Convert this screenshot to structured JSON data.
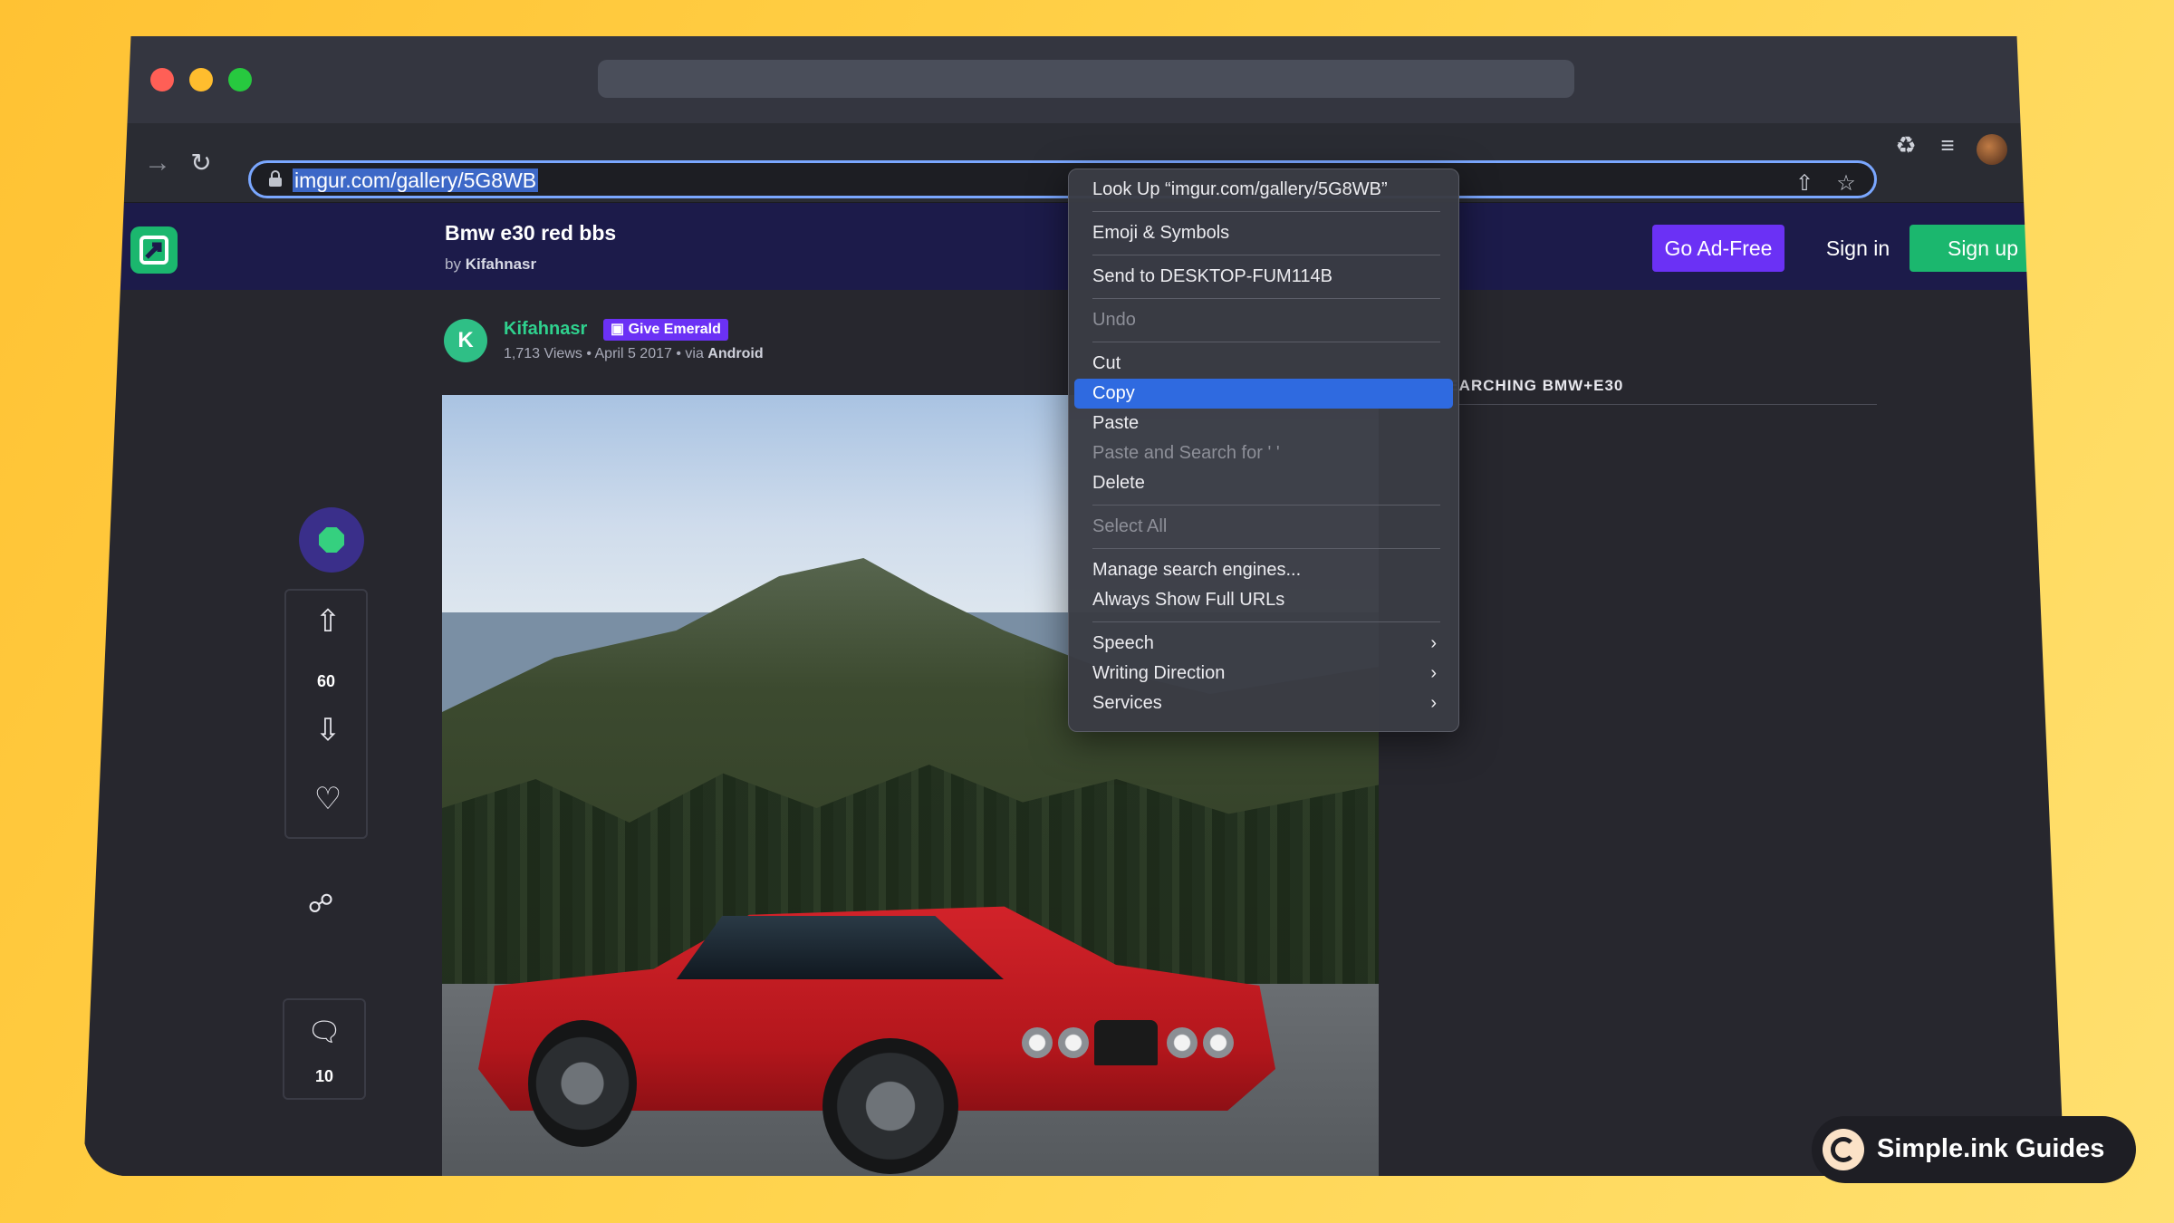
{
  "browser": {
    "url": "imgur.com/gallery/5G8WB"
  },
  "header": {
    "title": "Bmw e30 red bbs",
    "by_prefix": "by",
    "author": "Kifahnasr",
    "go_ad_free": "Go Ad-Free",
    "sign_in": "Sign in",
    "sign_up": "Sign up"
  },
  "post": {
    "author_initial": "K",
    "author": "Kifahnasr",
    "give_emerald": "Give Emerald",
    "views": "1,713 Views",
    "date": "April 5 2017",
    "via_prefix": "via",
    "via": "Android",
    "votes": "60",
    "comments": "10"
  },
  "sidebar": {
    "search_title": "SEARCHING BMW+E30"
  },
  "context_menu": {
    "look_up": "Look Up “imgur.com/gallery/5G8WB”",
    "emoji": "Emoji & Symbols",
    "send_to": "Send to DESKTOP-FUM114B",
    "undo": "Undo",
    "cut": "Cut",
    "copy": "Copy",
    "paste": "Paste",
    "paste_search": "Paste and Search for ' '",
    "delete": "Delete",
    "select_all": "Select All",
    "manage_engines": "Manage search engines...",
    "full_urls": "Always Show Full URLs",
    "speech": "Speech",
    "writing_direction": "Writing Direction",
    "services": "Services"
  },
  "badge": {
    "text": "Simple.ink Guides"
  },
  "colors": {
    "background": "#ffc233",
    "header": "#1c1b4a",
    "accent_green": "#1bb76e",
    "accent_purple": "#6b31f5",
    "menu_highlight": "#2f6ae0"
  }
}
